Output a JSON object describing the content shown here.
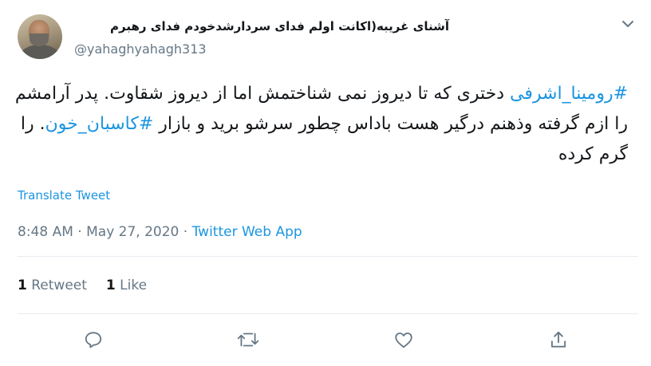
{
  "author": {
    "display_name": "آشنای غریبه(اکانت اولم فدای سردارشدخودم فدای رهبرم",
    "handle": "@yahaghyahagh313",
    "avatar": "profile-photo-icon"
  },
  "tweet": {
    "hashtag_1": "#رومینا_اشرفی",
    "text_1": "دختری که تا دیروز نمی شناختمش اما از دیروز شقاوت. پدر آرامشم را ازم گرفته وذهنم درگیر هست باداس چطور سرشو برید و بازار",
    "hashtag_2": "#کاسبان_خون",
    "text_2": ". را گرم کرده"
  },
  "translate_label": "Translate Tweet",
  "meta": {
    "time": "8:48 AM",
    "separator": "·",
    "date": "May 27, 2020",
    "source": "Twitter Web App"
  },
  "stats": {
    "retweet_count": "1",
    "retweet_label": "Retweet",
    "like_count": "1",
    "like_label": "Like"
  },
  "actions": {
    "reply_icon": "reply-icon",
    "retweet_icon": "retweet-icon",
    "like_icon": "heart-icon",
    "share_icon": "share-icon"
  },
  "colors": {
    "link": "#1b95e0",
    "secondary_text": "#657786",
    "primary_text": "#14171a",
    "divider": "#e6ecf0"
  }
}
